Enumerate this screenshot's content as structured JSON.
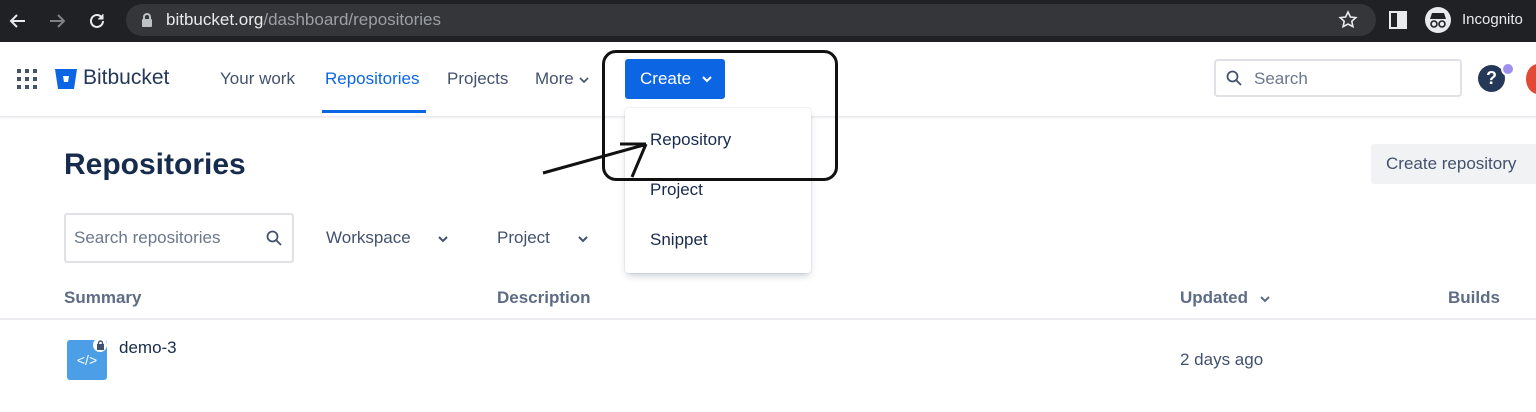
{
  "browser": {
    "url_domain": "bitbucket.org",
    "url_path": "/dashboard/repositories",
    "incognito_label": "Incognito",
    "icons": [
      "back-icon",
      "forward-icon",
      "reload-icon",
      "lock-icon",
      "star-icon",
      "sidepanel-icon",
      "incognito-icon"
    ]
  },
  "header": {
    "brand": "Bitbucket",
    "nav": {
      "your_work": "Your work",
      "repositories": "Repositories",
      "projects": "Projects",
      "more": "More"
    },
    "create_label": "Create",
    "search_placeholder": "Search",
    "help_symbol": "?"
  },
  "dropdown": {
    "items": [
      "Repository",
      "Project",
      "Snippet"
    ]
  },
  "page": {
    "title": "Repositories",
    "create_repo_label": "Create repository",
    "search_placeholder": "Search repositories",
    "filters": {
      "workspace": "Workspace",
      "project": "Project"
    },
    "columns": {
      "summary": "Summary",
      "description": "Description",
      "updated": "Updated",
      "builds": "Builds"
    },
    "rows": [
      {
        "name": "demo-3",
        "updated": "2 days ago",
        "icon_text": "</>"
      }
    ]
  },
  "colors": {
    "brand_blue": "#0c66e4",
    "chrome_bg": "#202124",
    "repo_avatar": "#4c9ee6"
  }
}
